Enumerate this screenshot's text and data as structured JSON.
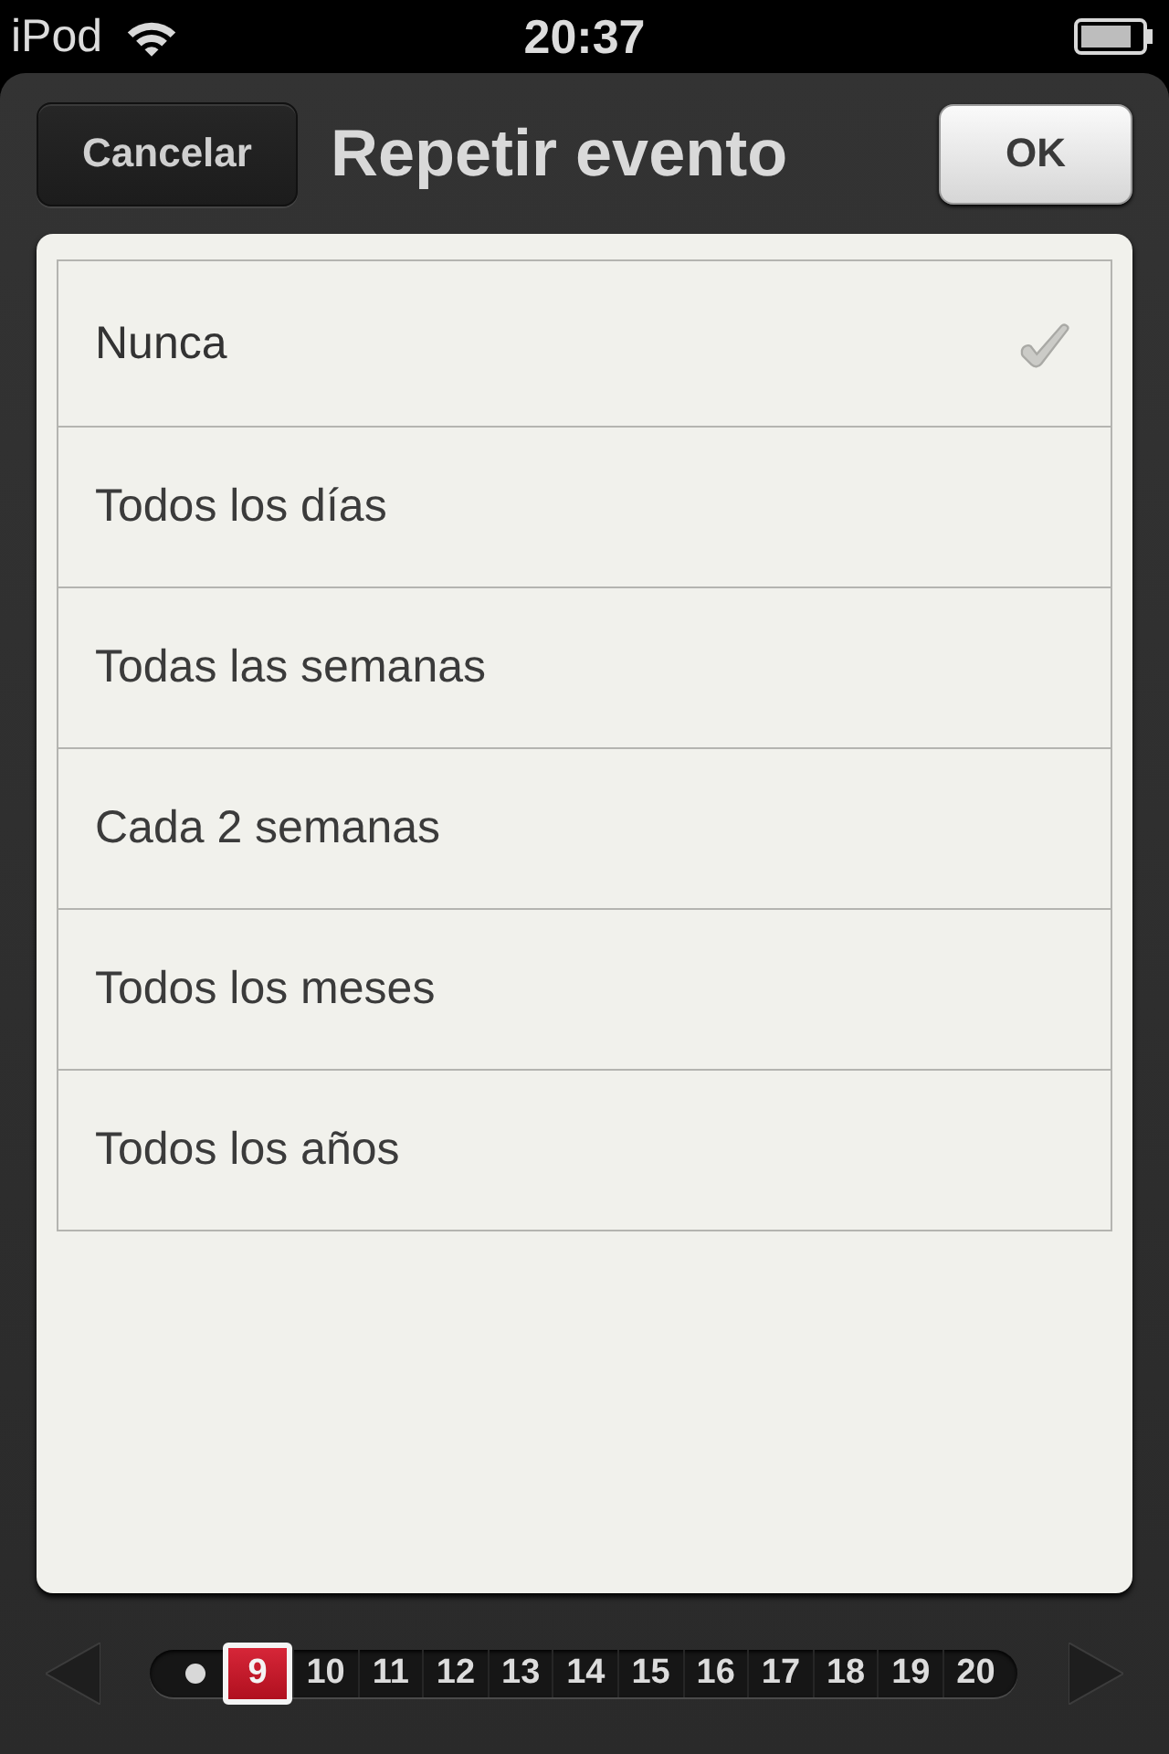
{
  "status_bar": {
    "carrier": "iPod",
    "time": "20:37"
  },
  "header": {
    "cancel_button": "Cancelar",
    "title": "Repetir evento",
    "ok_button": "OK"
  },
  "options": [
    {
      "label": "Nunca",
      "selected": true
    },
    {
      "label": "Todos los días",
      "selected": false
    },
    {
      "label": "Todas las semanas",
      "selected": false
    },
    {
      "label": "Cada 2 semanas",
      "selected": false
    },
    {
      "label": "Todos los meses",
      "selected": false
    },
    {
      "label": "Todos los años",
      "selected": false
    }
  ],
  "day_strip": {
    "days": [
      {
        "label": "9",
        "selected": true
      },
      {
        "label": "10",
        "selected": false
      },
      {
        "label": "11",
        "selected": false
      },
      {
        "label": "12",
        "selected": false
      },
      {
        "label": "13",
        "selected": false
      },
      {
        "label": "14",
        "selected": false
      },
      {
        "label": "15",
        "selected": false
      },
      {
        "label": "16",
        "selected": false
      },
      {
        "label": "17",
        "selected": false
      },
      {
        "label": "18",
        "selected": false
      },
      {
        "label": "19",
        "selected": false
      },
      {
        "label": "20",
        "selected": false
      }
    ]
  }
}
